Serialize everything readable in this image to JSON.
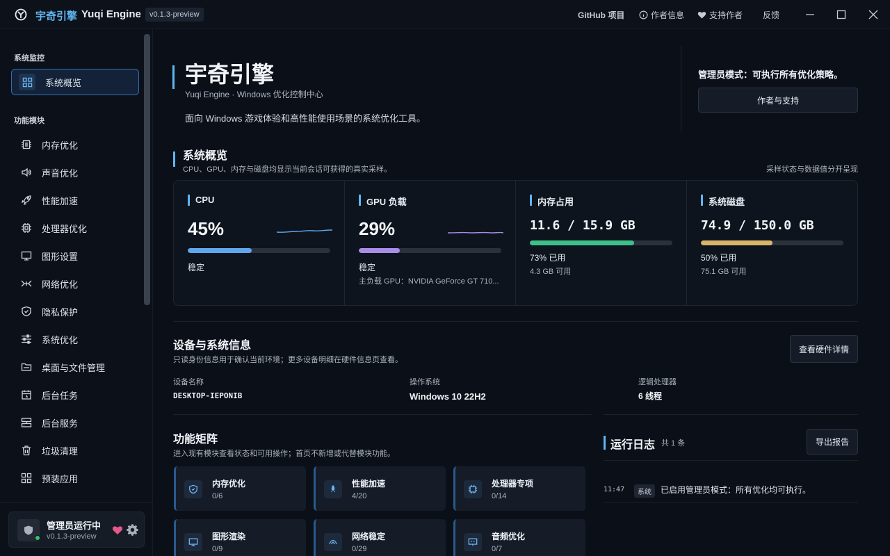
{
  "titlebar": {
    "app_cn": "宇奇引擎",
    "app_en": "Yuqi Engine",
    "version": "v0.1.3-preview",
    "links": {
      "github": "GitHub 项目",
      "author_info": "作者信息",
      "support": "支持作者",
      "feedback": "反馈"
    }
  },
  "sidebar": {
    "section_monitor": "系统监控",
    "overview": "系统概览",
    "section_modules": "功能模块",
    "items": [
      {
        "label": "内存优化",
        "icon": "chip-icon"
      },
      {
        "label": "声音优化",
        "icon": "speaker-icon"
      },
      {
        "label": "性能加速",
        "icon": "rocket-icon"
      },
      {
        "label": "处理器优化",
        "icon": "cpu-icon"
      },
      {
        "label": "图形设置",
        "icon": "monitor-icon"
      },
      {
        "label": "网络优化",
        "icon": "network-icon"
      },
      {
        "label": "隐私保护",
        "icon": "shield-icon"
      },
      {
        "label": "系统优化",
        "icon": "sliders-icon"
      },
      {
        "label": "桌面与文件管理",
        "icon": "folder-icon"
      },
      {
        "label": "后台任务",
        "icon": "calendar-icon"
      },
      {
        "label": "后台服务",
        "icon": "server-icon"
      },
      {
        "label": "垃圾清理",
        "icon": "trash-icon"
      },
      {
        "label": "预装应用",
        "icon": "apps-icon"
      }
    ],
    "footer": {
      "status": "管理员运行中",
      "version": "v0.1.3-preview"
    }
  },
  "hero": {
    "title": "宇奇引擎",
    "subtitle": "Yuqi Engine · Windows 优化控制中心",
    "description": "面向 Windows 游戏体验和高性能使用场景的系统优化工具。",
    "admin_text": "管理员模式：可执行所有优化策略。",
    "author_button": "作者与支持"
  },
  "overview": {
    "title": "系统概览",
    "subtitle": "CPU、GPU、内存与磁盘均显示当前会话可获得的真实采样。",
    "right_note": "采样状态与数据值分开呈现",
    "stats": [
      {
        "label": "CPU",
        "value": "45%",
        "fraction": 0.45,
        "color": "#5fa6ef",
        "line1": "稳定",
        "line2": ""
      },
      {
        "label": "GPU 负载",
        "value": "29%",
        "fraction": 0.29,
        "color": "#a98ce8",
        "line1": "稳定",
        "line2": "主负载 GPU：NVIDIA GeForce GT 710..."
      },
      {
        "label": "内存占用",
        "value": "11.6 / 15.9 GB",
        "fraction": 0.73,
        "color": "#3fbf8a",
        "line1": "73% 已用",
        "line2": "4.3 GB 可用"
      },
      {
        "label": "系统磁盘",
        "value": "74.9 / 150.0 GB",
        "fraction": 0.5,
        "color": "#d9b56a",
        "line1": "50% 已用",
        "line2": "75.1 GB 可用"
      }
    ]
  },
  "device": {
    "title": "设备与系统信息",
    "subtitle": "只读身份信息用于确认当前环境；更多设备明细在硬件信息页查看。",
    "button": "查看硬件详情",
    "fields": [
      {
        "label": "设备名称",
        "value": "DESKTOP-IEPONIB"
      },
      {
        "label": "操作系统",
        "value": "Windows 10 22H2"
      },
      {
        "label": "逻辑处理器",
        "value": "6 线程"
      }
    ]
  },
  "matrix": {
    "title": "功能矩阵",
    "subtitle": "进入现有模块查看状态和可用操作；首页不新增或代替模块功能。",
    "tiles": [
      {
        "name": "内存优化",
        "count": "0/6",
        "icon": "shield-icon"
      },
      {
        "name": "性能加速",
        "count": "4/20",
        "icon": "rocket-icon"
      },
      {
        "name": "处理器专项",
        "count": "0/14",
        "icon": "cpu-icon"
      },
      {
        "name": "图形渲染",
        "count": "0/9",
        "icon": "monitor-icon"
      },
      {
        "name": "网络稳定",
        "count": "0/29",
        "icon": "network-icon"
      },
      {
        "name": "音频优化",
        "count": "0/7",
        "icon": "speaker-icon"
      }
    ]
  },
  "log": {
    "title": "运行日志",
    "count": "共 1 条",
    "export_button": "导出报告",
    "entries": [
      {
        "time": "11:47",
        "tag": "系统",
        "message": "已启用管理员模式：所有优化均可执行。"
      }
    ]
  }
}
